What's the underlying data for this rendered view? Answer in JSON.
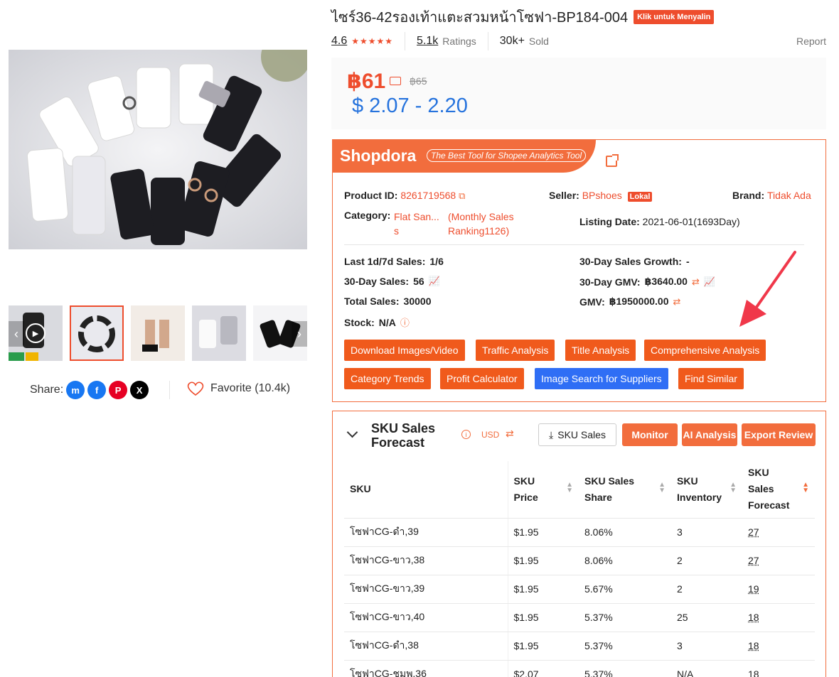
{
  "product": {
    "title": "ไซร์36-42รองเท้าแตะสวมหน้าโซฟา-BP184-004",
    "copy_badge": "Klik untuk Menyalin",
    "rating": "4.6",
    "ratings_count": "5.1k",
    "ratings_label": "Ratings",
    "sold_count": "30k+",
    "sold_label": "Sold",
    "report_label": "Report",
    "price": "฿61",
    "price_original": "฿65",
    "price_usd": "$ 2.07 - 2.20"
  },
  "share": {
    "label": "Share:",
    "favorite_label": "Favorite (10.4k)",
    "icons": [
      "messenger-icon",
      "facebook-icon",
      "pinterest-icon",
      "x-icon"
    ]
  },
  "shopdora": {
    "brand": "Shopdora",
    "tagline": "The Best Tool for Shopee Analytics Tool",
    "product_id_label": "Product ID:",
    "product_id": "8261719568",
    "seller_label": "Seller:",
    "seller": "BPshoes",
    "seller_badge": "Lokal",
    "brand_label": "Brand:",
    "brand_value": "Tidak Ada",
    "category_label": "Category:",
    "category_value_line1": "Flat San...",
    "category_value_line2": "s",
    "ranking_line1": "(Monthly Sales",
    "ranking_line2": "Ranking1126)",
    "listing_label": "Listing Date:",
    "listing_value": "2021-06-01(1693Day)",
    "stats": {
      "last_sales_label": "Last 1d/7d Sales:",
      "last_sales": "1/6",
      "growth_label": "30-Day Sales Growth:",
      "growth": "-",
      "sales30_label": "30-Day Sales:",
      "sales30": "56",
      "gmv30_label": "30-Day GMV:",
      "gmv30": "฿3640.00",
      "total_label": "Total Sales:",
      "total": "30000",
      "gmv_label": "GMV:",
      "gmv": "฿1950000.00",
      "stock_label": "Stock:",
      "stock": "N/A"
    },
    "buttons": {
      "download": "Download Images/Video",
      "traffic": "Traffic Analysis",
      "title_analysis": "Title Analysis",
      "comprehensive": "Comprehensive Analysis",
      "category": "Category Trends",
      "profit": "Profit Calculator",
      "image_search": "Image Search for Suppliers",
      "similar": "Find Similar"
    }
  },
  "sku": {
    "title_line1": "SKU Sales",
    "title_line2": "Forecast",
    "currency": "USD",
    "buttons": {
      "sku_sales": "SKU Sales",
      "monitor": "Monitor",
      "ai": "AI Analysis",
      "export": "Export Review"
    },
    "headers": {
      "sku": "SKU",
      "price_1": "SKU",
      "price_2": "Price",
      "share_1": "SKU Sales",
      "share_2": "Share",
      "inv_1": "SKU",
      "inv_2": "Inventory",
      "fc_1": "SKU",
      "fc_2": "Sales",
      "fc_3": "Forecast"
    },
    "rows": [
      {
        "sku": "โซฟาCG-ดำ,39",
        "price": "$1.95",
        "share": "8.06%",
        "inventory": "3",
        "forecast": "27"
      },
      {
        "sku": "โซฟาCG-ขาว,38",
        "price": "$1.95",
        "share": "8.06%",
        "inventory": "2",
        "forecast": "27"
      },
      {
        "sku": "โซฟาCG-ขาว,39",
        "price": "$1.95",
        "share": "5.67%",
        "inventory": "2",
        "forecast": "19"
      },
      {
        "sku": "โซฟาCG-ขาว,40",
        "price": "$1.95",
        "share": "5.37%",
        "inventory": "25",
        "forecast": "18"
      },
      {
        "sku": "โซฟาCG-ดำ,38",
        "price": "$1.95",
        "share": "5.37%",
        "inventory": "3",
        "forecast": "18"
      },
      {
        "sku": "โซฟาCG-ชมพ,36",
        "price": "$2.07",
        "share": "5.37%",
        "inventory": "N/A",
        "forecast": "18"
      }
    ]
  },
  "colors": {
    "accent": "#ee4d2d",
    "shopdora": "#f26d3d",
    "usd_price": "#2673dd",
    "blue_button": "#2f6ef5"
  }
}
